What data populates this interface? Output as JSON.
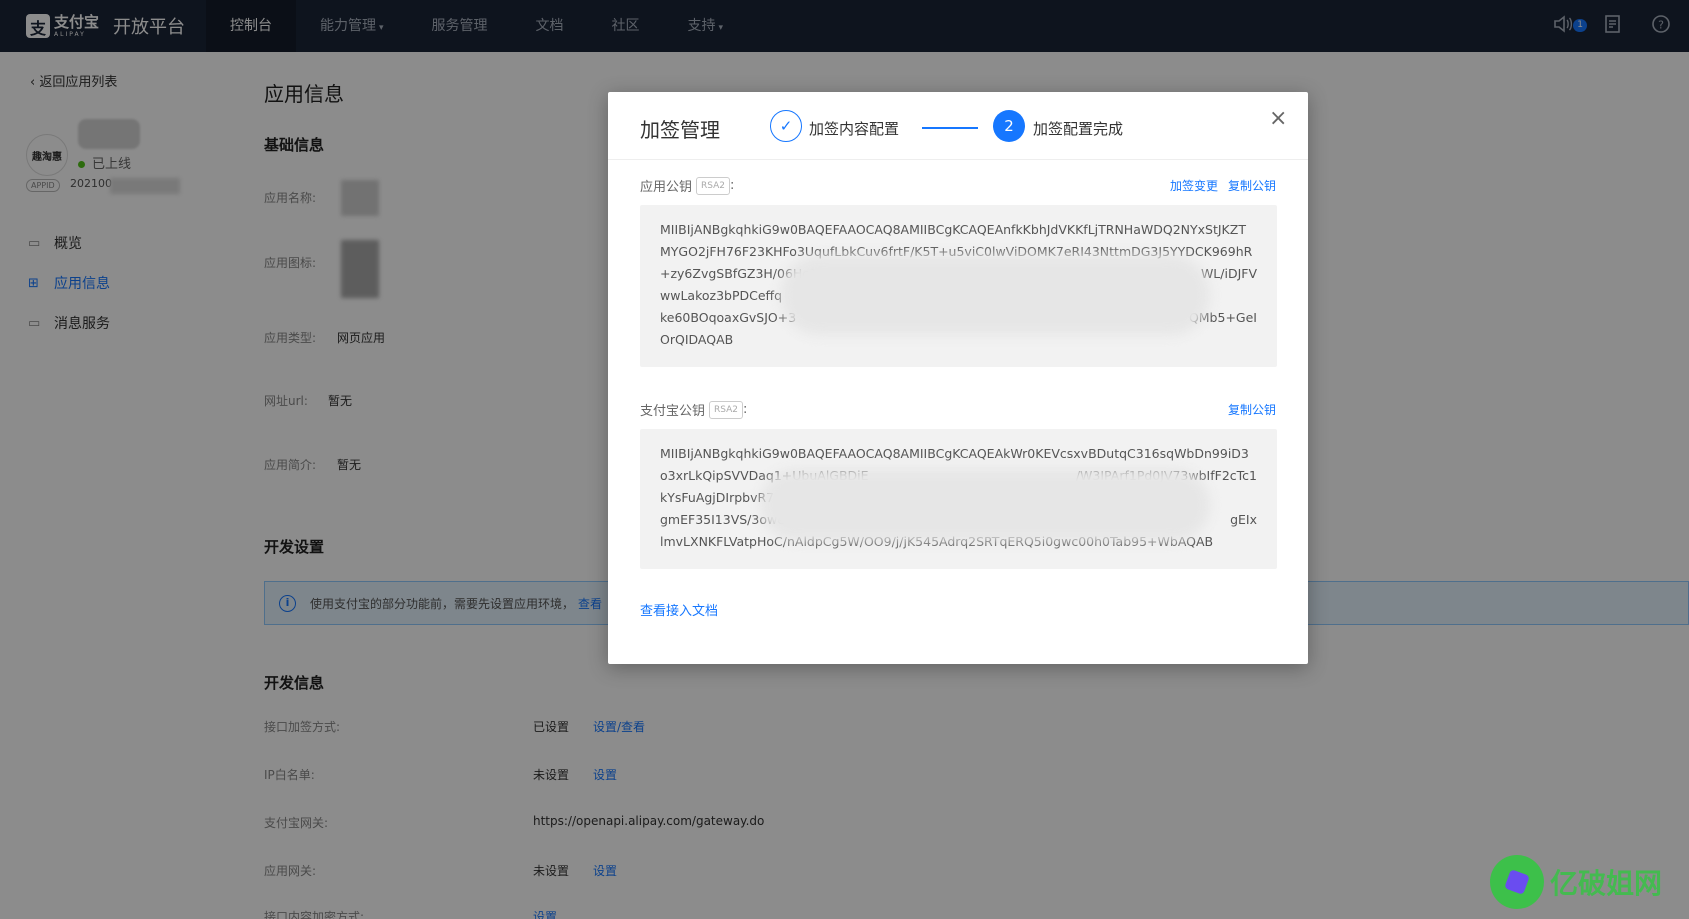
{
  "topnav": {
    "logo_cn": "支付宝",
    "logo_en": "ALIPAY",
    "platform": "开放平台",
    "items": [
      {
        "label": "控制台",
        "active": true,
        "has_caret": false
      },
      {
        "label": "能力管理",
        "active": false,
        "has_caret": true
      },
      {
        "label": "服务管理",
        "active": false,
        "has_caret": false
      },
      {
        "label": "文档",
        "active": false,
        "has_caret": false
      },
      {
        "label": "社区",
        "active": false,
        "has_caret": false
      },
      {
        "label": "支持",
        "active": false,
        "has_caret": true
      }
    ],
    "notification_count": "1",
    "icons": [
      "speaker-icon",
      "document-icon",
      "help-icon"
    ]
  },
  "sidebar": {
    "back_label": "返回应用列表",
    "app_logo_text": "趣淘惠",
    "status": "已上线",
    "appid_tag": "APPID",
    "appid_value": "202100",
    "menu": [
      {
        "label": "概览",
        "icon": "monitor-icon",
        "active": false
      },
      {
        "label": "应用信息",
        "icon": "grid-icon",
        "active": true
      },
      {
        "label": "消息服务",
        "icon": "monitor-icon",
        "active": false
      }
    ]
  },
  "main": {
    "title": "应用信息",
    "basic_section": "基础信息",
    "fields": {
      "app_name_label": "应用名称:",
      "app_icon_label": "应用图标:",
      "app_type_label": "应用类型:",
      "app_type_value": "网页应用",
      "url_label": "网址url:",
      "url_value": "暂无",
      "intro_label": "应用简介:",
      "intro_value": "暂无"
    },
    "dev_settings_section": "开发设置",
    "alert_text": "使用支付宝的部分功能前，需要先设置应用环境，",
    "alert_link": "查看",
    "dev_info_section": "开发信息",
    "dev_info": {
      "sign_label": "接口加签方式:",
      "sign_value": "已设置",
      "sign_link": "设置/查看",
      "ip_label": "IP白名单:",
      "ip_value": "未设置",
      "ip_link": "设置",
      "gateway_label": "支付宝网关:",
      "gateway_value": "https://openapi.alipay.com/gateway.do",
      "app_gateway_label": "应用网关:",
      "app_gateway_value": "未设置",
      "app_gateway_link": "设置",
      "encrypt_label": "接口内容加密方式:",
      "encrypt_link": "设置"
    }
  },
  "modal": {
    "title": "加签管理",
    "step1_label": "加签内容配置",
    "step2_number": "2",
    "step2_label": "加签配置完成",
    "close_glyph": "×",
    "app_key": {
      "label": "应用公钥",
      "tag": "RSA2",
      "action_change": "加签变更",
      "action_copy": "复制公钥",
      "lines": [
        "MIIBIjANBgkqhkiG9w0BAQEFAAOCAQ8AMIIBCgKCAQEAnfkKbhJdVKKfLjTRNHaWDQ2NYxStJKZT",
        "MYGO2jFH76F23KHFo3UqufLbkCuv6frtF/K5T+u5viC0lwViDOMK7eRI43NttmDG3J5YYDCK969hR",
        "+zy6ZvgSBfGZ3H/06Hc1ixxOBVB",
        "wwLakoz3bPDCeffq",
        "ke60BOqoaxGvSJO+3",
        "OrQIDAQAB"
      ],
      "line3_tail": "WL/iDJFV",
      "line5_tail": "QMb5+GeI"
    },
    "alipay_key": {
      "label": "支付宝公钥",
      "tag": "RSA2",
      "action_copy": "复制公钥",
      "lines": [
        "MIIBIjANBgkqhkiG9w0BAQEFAAOCAQ8AMIIBCgKCAQEAkWr0KEVcsxvBDutqC316sqWbDn99iD3",
        "o3xrLkQipSVVDaq1+UbuAlGBDiE",
        "kYsFuAgjDIrpbvR7",
        "gmEF35I13VS/3owe+olzq35.",
        "lmvLXNKFLVatpHoC/nAldpCg5W/OO9/j/jK545Adrq2SRTqERQ5i0gwc00h0Tab95+WbAQAB"
      ],
      "line2_tail": "/W3IPArf1Pd0JV73wbIfF2cTc1",
      "line4_tail": "gEIx"
    },
    "doc_link": "查看接入文档"
  },
  "watermark": {
    "text": "亿破姐网"
  }
}
